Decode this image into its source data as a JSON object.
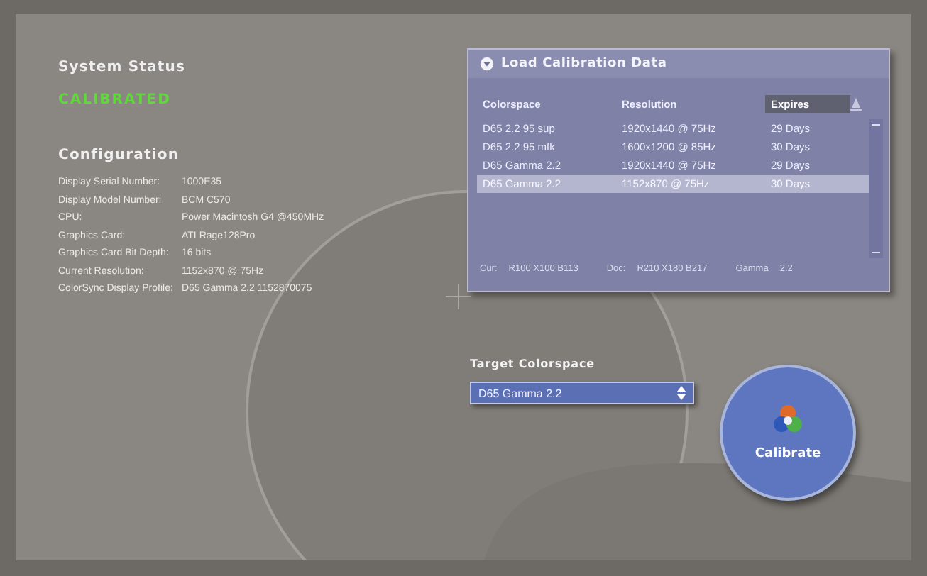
{
  "system_status": {
    "title": "System Status",
    "status": "CALIBRATED"
  },
  "configuration": {
    "title": "Configuration",
    "rows": [
      {
        "label": "Display Serial Number:",
        "value": "1000E35"
      },
      {
        "label": "Display Model Number:",
        "value": "BCM C570"
      },
      {
        "label": "CPU:",
        "value": "Power Macintosh G4 @450MHz"
      },
      {
        "label": "Graphics Card:",
        "value": "ATI Rage128Pro"
      },
      {
        "label": "Graphics Card Bit Depth:",
        "value": "16 bits"
      },
      {
        "label": "Current Resolution:",
        "value": "1152x870 @ 75Hz"
      },
      {
        "label": "ColorSync Display Profile:",
        "value": "D65 Gamma 2.2 1152870075"
      }
    ]
  },
  "calibration_panel": {
    "title": "Load Calibration Data",
    "columns": [
      {
        "label": "Colorspace",
        "selected": false
      },
      {
        "label": "Resolution",
        "selected": false
      },
      {
        "label": "Expires",
        "selected": true
      }
    ],
    "rows": [
      {
        "cells": [
          "D65 2.2 95 sup",
          "1920x1440 @ 75Hz",
          "29 Days"
        ],
        "selected": false
      },
      {
        "cells": [
          "D65 2.2 95 mfk",
          "1600x1200 @ 85Hz",
          "30 Days"
        ],
        "selected": false
      },
      {
        "cells": [
          "D65 Gamma 2.2",
          "1920x1440 @ 75Hz",
          "29 Days"
        ],
        "selected": false
      },
      {
        "cells": [
          "D65 Gamma 2.2",
          "1152x870 @ 75Hz",
          "30 Days"
        ],
        "selected": true
      }
    ],
    "footer": [
      "Cur:",
      "R100 X100 B113",
      "Doc:",
      "R210 X180 B217",
      "Gamma",
      "2.2"
    ]
  },
  "target_colorspace": {
    "label": "Target Colorspace",
    "value": "D65 Gamma 2.2"
  },
  "calibrate_button": {
    "label": "Calibrate"
  }
}
